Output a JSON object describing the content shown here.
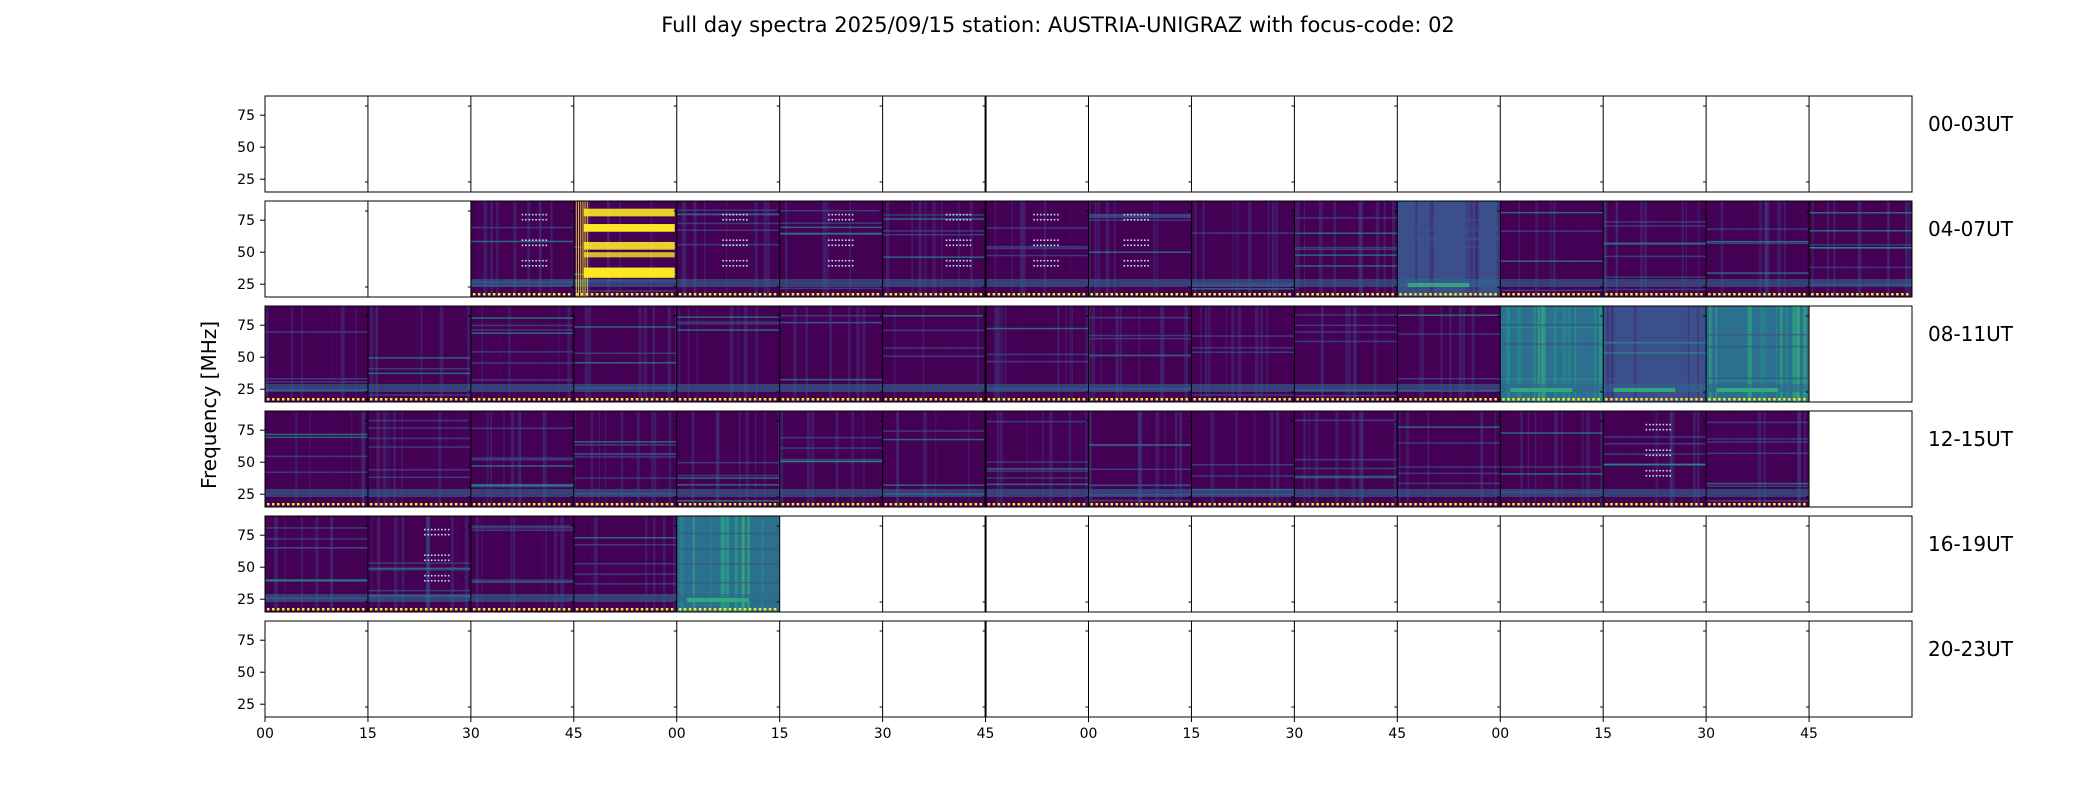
{
  "chart_data": {
    "type": "heatmap",
    "title": "Full day spectra 2025/09/15 station: AUSTRIA-UNIGRAZ with focus-code: 02",
    "ylabel": "Frequency [MHz]",
    "xlabel": "",
    "ylim": [
      15,
      90
    ],
    "y_ticks": [
      "75",
      "50",
      "25"
    ],
    "x_ticks": [
      "00",
      "15",
      "30",
      "45",
      "00",
      "15",
      "30",
      "45",
      "00",
      "15",
      "30",
      "45",
      "00",
      "15",
      "30",
      "45"
    ],
    "panels_per_row": 16,
    "colors": {
      "low": "#440154",
      "base": "#46085c",
      "mid": "#31688e",
      "teal": "#21918c",
      "green": "#35b779",
      "yellow": "#fde725"
    },
    "rows": [
      {
        "label": "00-03UT",
        "panels": [
          "empty",
          "empty",
          "empty",
          "empty",
          "empty",
          "empty",
          "empty",
          "empty",
          "empty",
          "empty",
          "empty",
          "empty",
          "empty",
          "empty",
          "empty",
          "empty"
        ]
      },
      {
        "label": "04-07UT",
        "panels": [
          "empty",
          "empty",
          "dots",
          "bright",
          "dots",
          "dots",
          "dots",
          "dots",
          "dots",
          "dark",
          "dark",
          "mid",
          "dark",
          "dark",
          "dark",
          "dark"
        ]
      },
      {
        "label": "08-11UT",
        "panels": [
          "dark",
          "dark",
          "dark",
          "dark",
          "dark",
          "dark",
          "dark",
          "dark",
          "dark",
          "dark",
          "dark",
          "dark",
          "teal",
          "mid",
          "teal",
          "empty"
        ]
      },
      {
        "label": "12-15UT",
        "panels": [
          "dark",
          "dark",
          "dark",
          "dark",
          "dark",
          "dark",
          "dark",
          "dark",
          "dark",
          "dark",
          "dark",
          "dark",
          "dark",
          "dots",
          "dark",
          "empty"
        ]
      },
      {
        "label": "16-19UT",
        "panels": [
          "dark",
          "dots",
          "dark",
          "dark",
          "teal",
          "empty",
          "empty",
          "empty",
          "empty",
          "empty",
          "empty",
          "empty",
          "empty",
          "empty",
          "empty",
          "empty"
        ]
      },
      {
        "label": "20-23UT",
        "panels": [
          "empty",
          "empty",
          "empty",
          "empty",
          "empty",
          "empty",
          "empty",
          "empty",
          "empty",
          "empty",
          "empty",
          "empty",
          "empty",
          "empty",
          "empty",
          "empty"
        ]
      }
    ]
  }
}
